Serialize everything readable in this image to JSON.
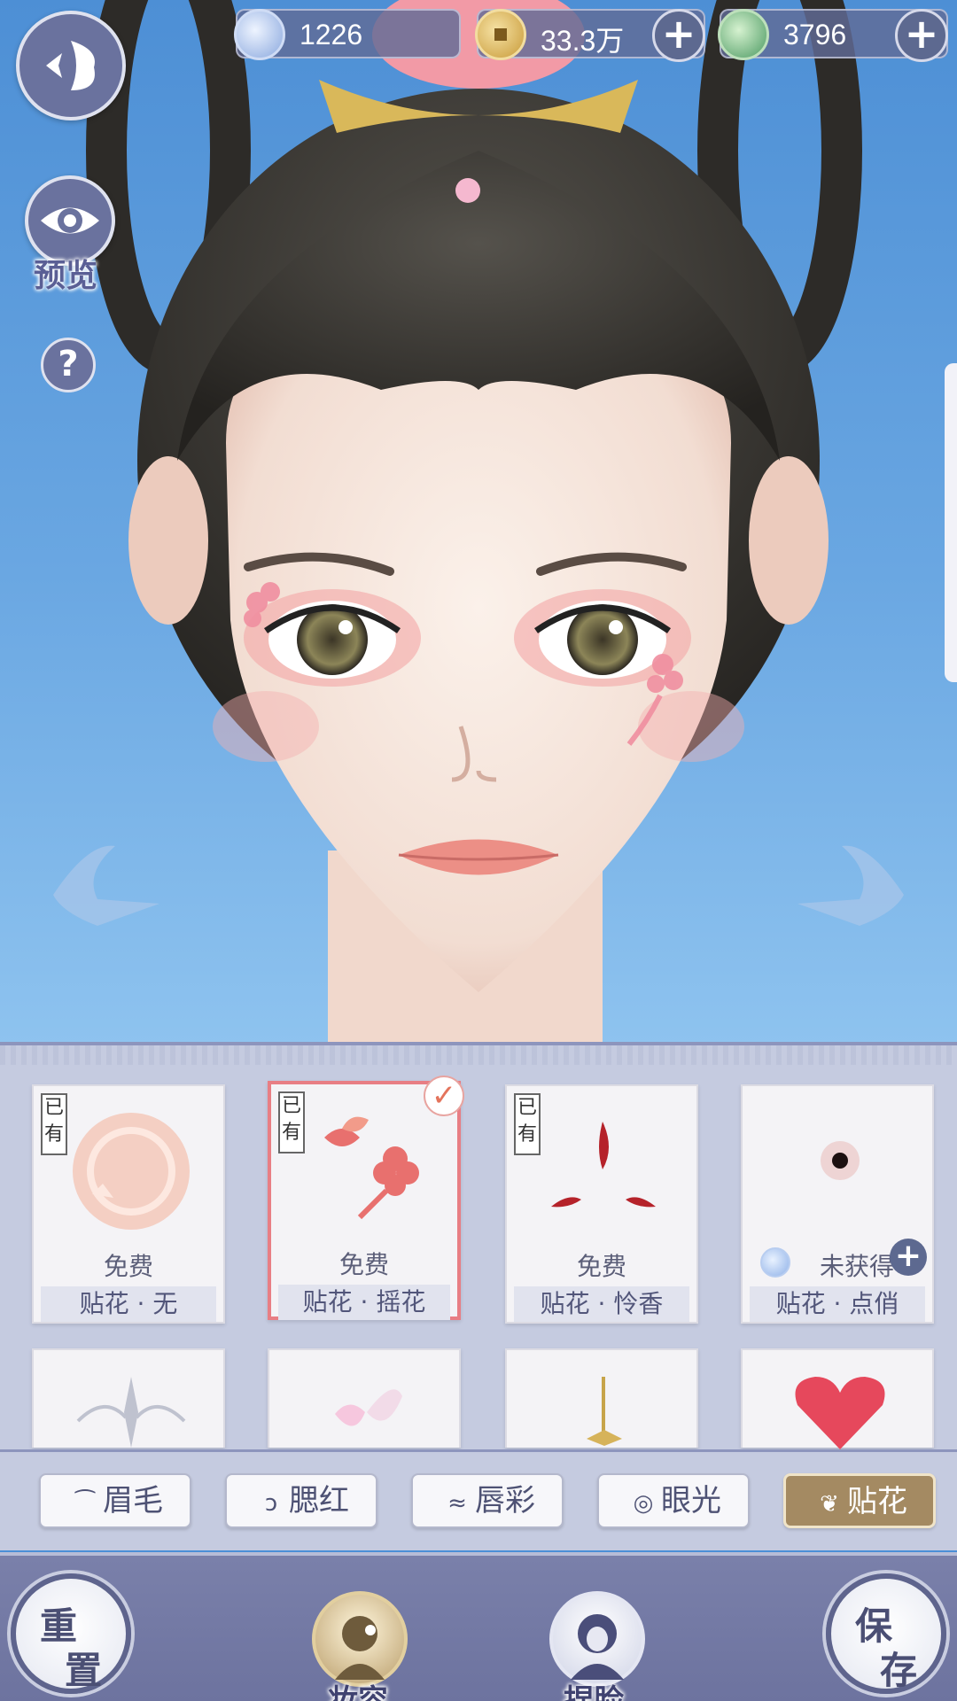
{
  "currencies": [
    {
      "icon": "jade-coin-icon",
      "value": "1226"
    },
    {
      "icon": "copper-coin-icon",
      "value": "33.3万"
    },
    {
      "icon": "dragon-token-icon",
      "value": "3796"
    }
  ],
  "controls": {
    "preview_label": "预览",
    "help_label": "?"
  },
  "items": [
    {
      "owned": "已有",
      "price": "免费",
      "name": "贴花 · 无",
      "selected": false
    },
    {
      "owned": "已有",
      "price": "免费",
      "name": "贴花 · 摇花",
      "selected": true
    },
    {
      "owned": "已有",
      "price": "免费",
      "name": "贴花 · 怜香",
      "selected": false
    },
    {
      "owned": "",
      "price": "未获得",
      "name": "贴花 · 点俏",
      "selected": false
    }
  ],
  "tabs": [
    {
      "label": "眉毛",
      "icon": "eyebrow-icon"
    },
    {
      "label": "腮红",
      "icon": "blush-icon"
    },
    {
      "label": "唇彩",
      "icon": "lips-icon"
    },
    {
      "label": "眼光",
      "icon": "eye-shine-icon"
    },
    {
      "label": "贴花",
      "icon": "petal-icon",
      "active": true
    }
  ],
  "bottom": {
    "reset": [
      "重",
      "置"
    ],
    "save": [
      "保",
      "存"
    ],
    "makeup_label": "妆容",
    "face_label": "捏脸"
  },
  "colors": {
    "sky": "#5a9ad9",
    "panel": "#c5cbe0",
    "accent_gold": "#a48a62",
    "selected_border": "#e87e84",
    "button_navy": "#5d6990"
  }
}
